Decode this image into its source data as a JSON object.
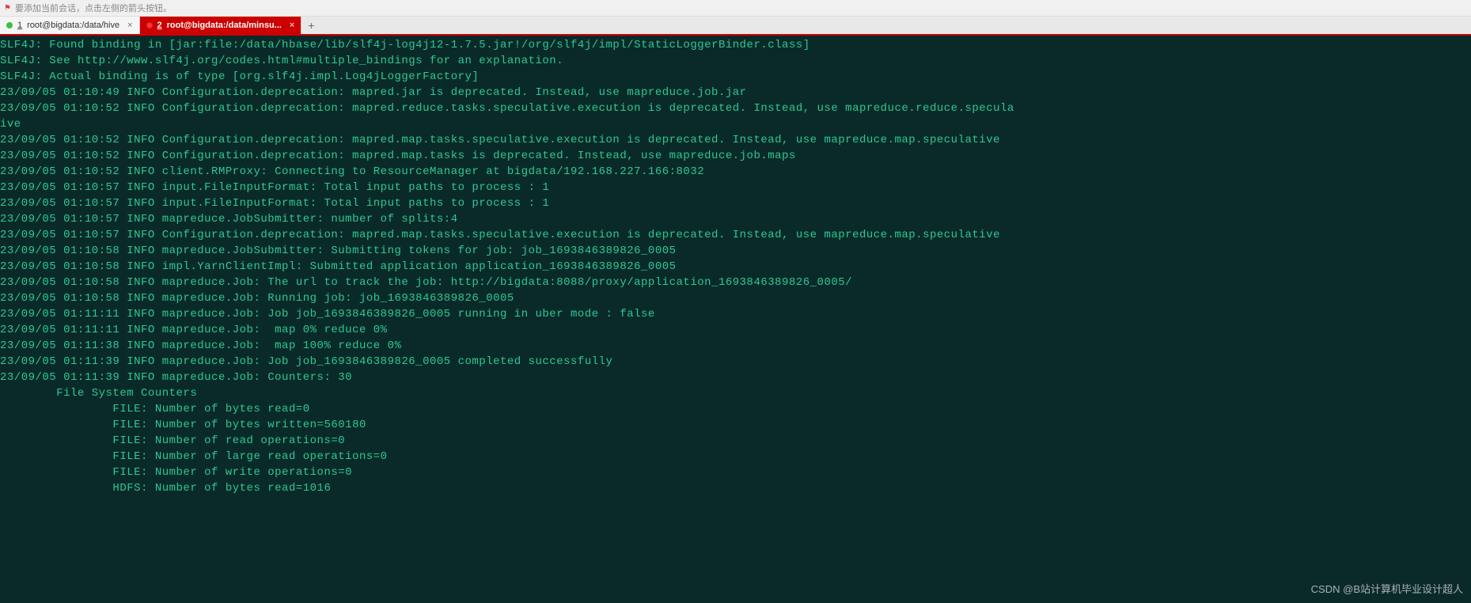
{
  "hint_text": "要添加当前会话，点击左侧的箭头按钮。",
  "tabs": [
    {
      "num": "1",
      "label": "root@bigdata:/data/hive"
    },
    {
      "num": "2",
      "label": "root@bigdata:/data/minsu..."
    }
  ],
  "terminal_lines": [
    "SLF4J: Found binding in [jar:file:/data/hbase/lib/slf4j-log4j12-1.7.5.jar!/org/slf4j/impl/StaticLoggerBinder.class]",
    "SLF4J: See http://www.slf4j.org/codes.html#multiple_bindings for an explanation.",
    "SLF4J: Actual binding is of type [org.slf4j.impl.Log4jLoggerFactory]",
    "23/09/05 01:10:49 INFO Configuration.deprecation: mapred.jar is deprecated. Instead, use mapreduce.job.jar",
    "23/09/05 01:10:52 INFO Configuration.deprecation: mapred.reduce.tasks.speculative.execution is deprecated. Instead, use mapreduce.reduce.specula",
    "ive",
    "23/09/05 01:10:52 INFO Configuration.deprecation: mapred.map.tasks.speculative.execution is deprecated. Instead, use mapreduce.map.speculative",
    "23/09/05 01:10:52 INFO Configuration.deprecation: mapred.map.tasks is deprecated. Instead, use mapreduce.job.maps",
    "23/09/05 01:10:52 INFO client.RMProxy: Connecting to ResourceManager at bigdata/192.168.227.166:8032",
    "23/09/05 01:10:57 INFO input.FileInputFormat: Total input paths to process : 1",
    "23/09/05 01:10:57 INFO input.FileInputFormat: Total input paths to process : 1",
    "23/09/05 01:10:57 INFO mapreduce.JobSubmitter: number of splits:4",
    "23/09/05 01:10:57 INFO Configuration.deprecation: mapred.map.tasks.speculative.execution is deprecated. Instead, use mapreduce.map.speculative",
    "23/09/05 01:10:58 INFO mapreduce.JobSubmitter: Submitting tokens for job: job_1693846389826_0005",
    "23/09/05 01:10:58 INFO impl.YarnClientImpl: Submitted application application_1693846389826_0005",
    "23/09/05 01:10:58 INFO mapreduce.Job: The url to track the job: http://bigdata:8088/proxy/application_1693846389826_0005/",
    "23/09/05 01:10:58 INFO mapreduce.Job: Running job: job_1693846389826_0005",
    "23/09/05 01:11:11 INFO mapreduce.Job: Job job_1693846389826_0005 running in uber mode : false",
    "23/09/05 01:11:11 INFO mapreduce.Job:  map 0% reduce 0%",
    "23/09/05 01:11:38 INFO mapreduce.Job:  map 100% reduce 0%",
    "23/09/05 01:11:39 INFO mapreduce.Job: Job job_1693846389826_0005 completed successfully",
    "23/09/05 01:11:39 INFO mapreduce.Job: Counters: 30",
    "        File System Counters",
    "                FILE: Number of bytes read=0",
    "                FILE: Number of bytes written=560180",
    "                FILE: Number of read operations=0",
    "                FILE: Number of large read operations=0",
    "                FILE: Number of write operations=0",
    "                HDFS: Number of bytes read=1016"
  ],
  "watermark": "CSDN @B站计算机毕业设计超人"
}
